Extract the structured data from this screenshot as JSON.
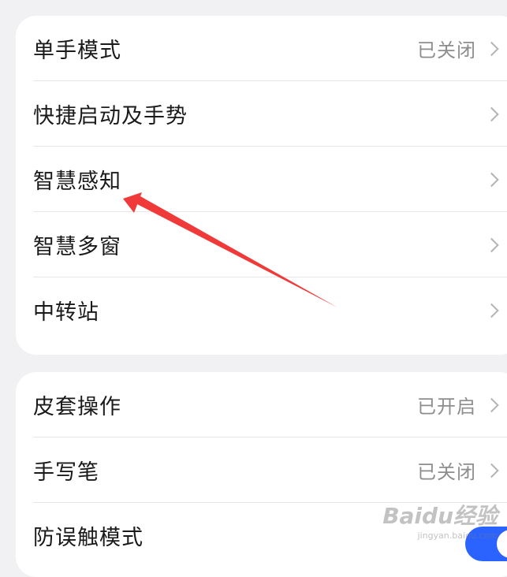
{
  "group1": {
    "items": [
      {
        "label": "单手模式",
        "value": "已关闭"
      },
      {
        "label": "快捷启动及手势",
        "value": ""
      },
      {
        "label": "智慧感知",
        "value": ""
      },
      {
        "label": "智慧多窗",
        "value": ""
      },
      {
        "label": "中转站",
        "value": ""
      }
    ]
  },
  "group2": {
    "items": [
      {
        "label": "皮套操作",
        "value": "已开启"
      },
      {
        "label": "手写笔",
        "value": "已关闭"
      },
      {
        "label": "防误触模式",
        "value": ""
      }
    ],
    "toggle_state": "on"
  },
  "annotation": {
    "color": "#f03a3a",
    "points_to": "智慧感知"
  },
  "watermark": {
    "logo": "Baidu经验",
    "url": "jingyan.baidu.com"
  },
  "accent_color": "#2a63ff"
}
